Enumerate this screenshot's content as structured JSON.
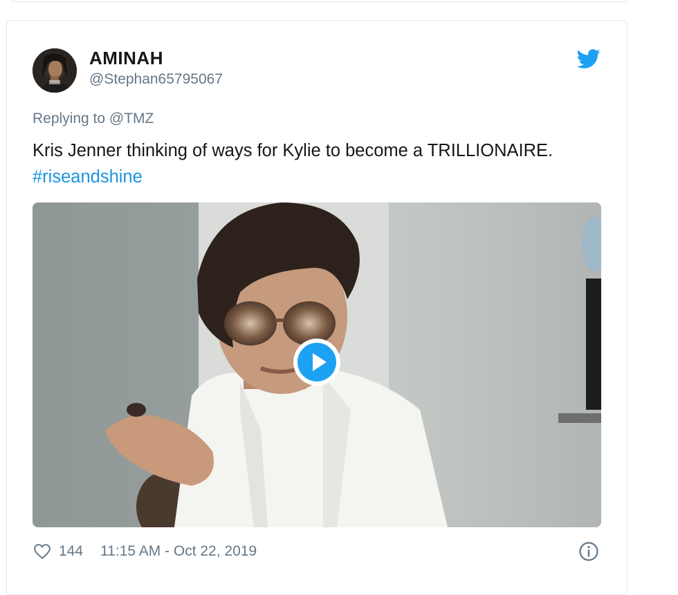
{
  "tweet": {
    "display_name": "AMINAH",
    "handle": "@Stephan65795067",
    "replying_prefix": "Replying to",
    "replying_to": "@TMZ",
    "text": "Kris Jenner thinking of ways for Kylie to become a TRILLIONAIRE.",
    "hashtag": "#riseandshine",
    "like_count": "144",
    "timestamp": "11:15 AM - Oct 22, 2019"
  },
  "icons": {
    "brand": "twitter-bird-icon",
    "like": "heart-icon",
    "info": "info-icon",
    "play": "play-icon"
  },
  "colors": {
    "twitter_blue": "#1da1f2",
    "hashtag_blue": "#1b95e0",
    "secondary_text": "#657786",
    "primary_text": "#14171a",
    "border": "#e1e8ed"
  }
}
